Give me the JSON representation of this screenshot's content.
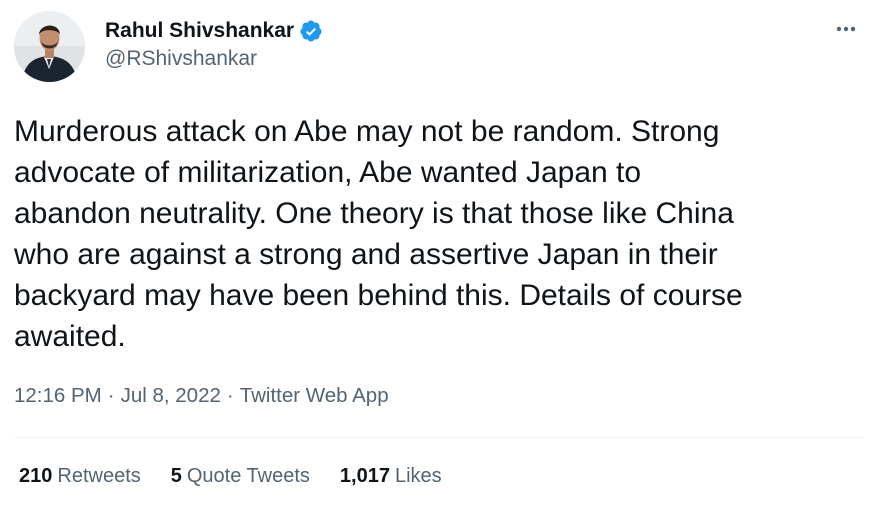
{
  "author": {
    "display_name": "Rahul Shivshankar",
    "handle": "@RShivshankar",
    "verified": true,
    "avatar_icon": "profile-photo"
  },
  "menu": {
    "icon": "more-icon",
    "glyph": "•••"
  },
  "tweet": {
    "text": "Murderous attack on Abe may not be random. Strong\nadvocate of militarization, Abe wanted Japan to\nabandon neutrality. One theory is that those like China\nwho are against a strong and assertive Japan in their\nbackyard may have been behind this. Details of course\nawaited.",
    "time": "12:16 PM",
    "date": "Jul 8, 2022",
    "separator": "·",
    "source": "Twitter Web App"
  },
  "stats": {
    "retweets_count": "210",
    "retweets_label": "Retweets",
    "quotes_count": "5",
    "quotes_label": "Quote Tweets",
    "likes_count": "1,017",
    "likes_label": "Likes"
  },
  "colors": {
    "text_primary": "#0f1419",
    "text_secondary": "#536471",
    "verified_blue": "#1d9bf0",
    "divider": "#eff3f4"
  }
}
